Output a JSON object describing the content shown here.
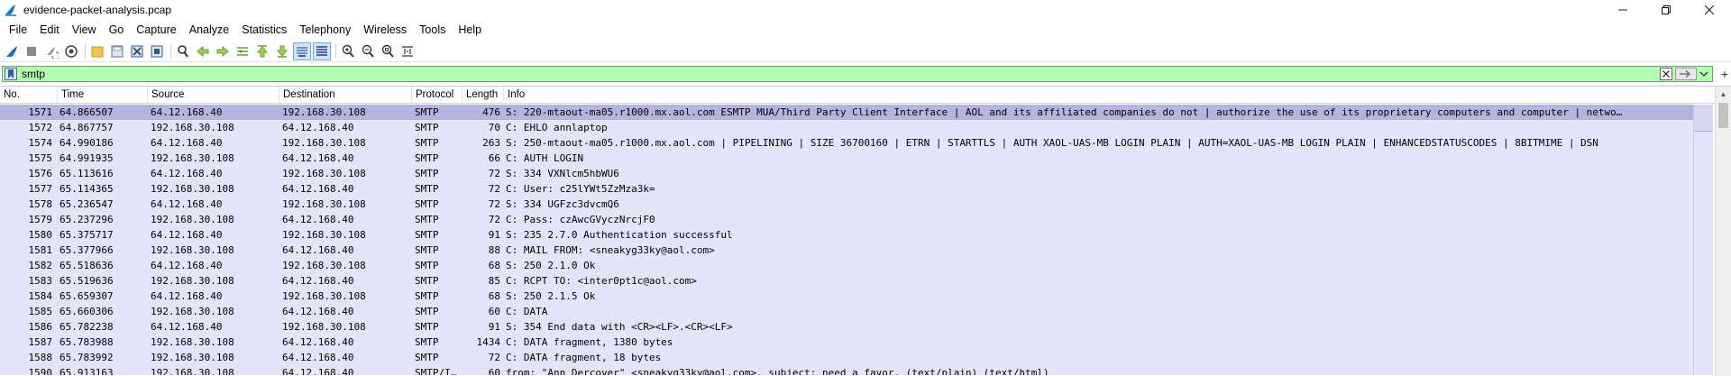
{
  "window": {
    "title": "evidence-packet-analysis.pcap",
    "controls": [
      "minimize",
      "restore",
      "close"
    ]
  },
  "menu": [
    "File",
    "Edit",
    "View",
    "Go",
    "Capture",
    "Analyze",
    "Statistics",
    "Telephony",
    "Wireless",
    "Tools",
    "Help"
  ],
  "toolbar": {
    "icons": [
      "shark-fin-start-icon",
      "stop-icon",
      "restart-icon",
      "capture-options-icon",
      "open-file-icon",
      "save-file-icon",
      "close-file-icon",
      "reload-icon",
      "find-icon",
      "go-back-icon",
      "go-forward-icon",
      "go-to-packet-icon",
      "go-first-icon",
      "go-last-icon",
      "autoscroll-icon",
      "colorize-icon",
      "zoom-in-icon",
      "zoom-out-icon",
      "zoom-normal-icon",
      "resize-columns-icon"
    ]
  },
  "filter": {
    "value": "smtp",
    "placeholder": ""
  },
  "columns": [
    "No.",
    "Time",
    "Source",
    "Destination",
    "Protocol",
    "Length",
    "Info"
  ],
  "packets": [
    {
      "no": "1571",
      "time": "64.866507",
      "src": "64.12.168.40",
      "dst": "192.168.30.108",
      "proto": "SMTP",
      "len": "476",
      "info": "S: 220-mtaout-ma05.r1000.mx.aol.com ESMTP MUA/Third Party Client Interface | AOL and its affiliated companies do not | authorize the use of its proprietary computers and computer | netwo…"
    },
    {
      "no": "1572",
      "time": "64.867757",
      "src": "192.168.30.108",
      "dst": "64.12.168.40",
      "proto": "SMTP",
      "len": "70",
      "info": "C: EHLO annlaptop"
    },
    {
      "no": "1574",
      "time": "64.990186",
      "src": "64.12.168.40",
      "dst": "192.168.30.108",
      "proto": "SMTP",
      "len": "263",
      "info": "S: 250-mtaout-ma05.r1000.mx.aol.com | PIPELINING | SIZE 36700160 | ETRN | STARTTLS | AUTH XAOL-UAS-MB LOGIN PLAIN | AUTH=XAOL-UAS-MB LOGIN PLAIN | ENHANCEDSTATUSCODES | 8BITMIME | DSN"
    },
    {
      "no": "1575",
      "time": "64.991935",
      "src": "192.168.30.108",
      "dst": "64.12.168.40",
      "proto": "SMTP",
      "len": "66",
      "info": "C: AUTH LOGIN"
    },
    {
      "no": "1576",
      "time": "65.113616",
      "src": "64.12.168.40",
      "dst": "192.168.30.108",
      "proto": "SMTP",
      "len": "72",
      "info": "S: 334 VXNlcm5hbWU6"
    },
    {
      "no": "1577",
      "time": "65.114365",
      "src": "192.168.30.108",
      "dst": "64.12.168.40",
      "proto": "SMTP",
      "len": "72",
      "info": "C: User: c25lYWt5ZzMza3k="
    },
    {
      "no": "1578",
      "time": "65.236547",
      "src": "64.12.168.40",
      "dst": "192.168.30.108",
      "proto": "SMTP",
      "len": "72",
      "info": "S: 334 UGFzc3dvcmQ6"
    },
    {
      "no": "1579",
      "time": "65.237296",
      "src": "192.168.30.108",
      "dst": "64.12.168.40",
      "proto": "SMTP",
      "len": "72",
      "info": "C: Pass: czAwcGVyczNrcjF0"
    },
    {
      "no": "1580",
      "time": "65.375717",
      "src": "64.12.168.40",
      "dst": "192.168.30.108",
      "proto": "SMTP",
      "len": "91",
      "info": "S: 235 2.7.0 Authentication successful"
    },
    {
      "no": "1581",
      "time": "65.377966",
      "src": "192.168.30.108",
      "dst": "64.12.168.40",
      "proto": "SMTP",
      "len": "88",
      "info": "C: MAIL FROM: <sneakyg33ky@aol.com>"
    },
    {
      "no": "1582",
      "time": "65.518636",
      "src": "64.12.168.40",
      "dst": "192.168.30.108",
      "proto": "SMTP",
      "len": "68",
      "info": "S: 250 2.1.0 Ok"
    },
    {
      "no": "1583",
      "time": "65.519636",
      "src": "192.168.30.108",
      "dst": "64.12.168.40",
      "proto": "SMTP",
      "len": "85",
      "info": "C: RCPT TO: <inter0pt1c@aol.com>"
    },
    {
      "no": "1584",
      "time": "65.659307",
      "src": "64.12.168.40",
      "dst": "192.168.30.108",
      "proto": "SMTP",
      "len": "68",
      "info": "S: 250 2.1.5 Ok"
    },
    {
      "no": "1585",
      "time": "65.660306",
      "src": "192.168.30.108",
      "dst": "64.12.168.40",
      "proto": "SMTP",
      "len": "60",
      "info": "C: DATA"
    },
    {
      "no": "1586",
      "time": "65.782238",
      "src": "64.12.168.40",
      "dst": "192.168.30.108",
      "proto": "SMTP",
      "len": "91",
      "info": "S: 354 End data with <CR><LF>.<CR><LF>"
    },
    {
      "no": "1587",
      "time": "65.783988",
      "src": "192.168.30.108",
      "dst": "64.12.168.40",
      "proto": "SMTP",
      "len": "1434",
      "info": "C: DATA fragment, 1380 bytes"
    },
    {
      "no": "1588",
      "time": "65.783992",
      "src": "192.168.30.108",
      "dst": "64.12.168.40",
      "proto": "SMTP",
      "len": "72",
      "info": "C: DATA fragment, 18 bytes"
    },
    {
      "no": "1590",
      "time": "65.913163",
      "src": "192.168.30.108",
      "dst": "64.12.168.40",
      "proto": "SMTP/I…",
      "len": "60",
      "info": "from: \"Ann Dercover\" <sneakyg33ky@aol.com>, subject: need a favor, (text/plain) (text/html)"
    }
  ],
  "selected_row": "1571",
  "colors": {
    "filter_valid": "#afffaf",
    "row_bg": "#e4e4fb",
    "row_selected": "#b4b4e0"
  }
}
